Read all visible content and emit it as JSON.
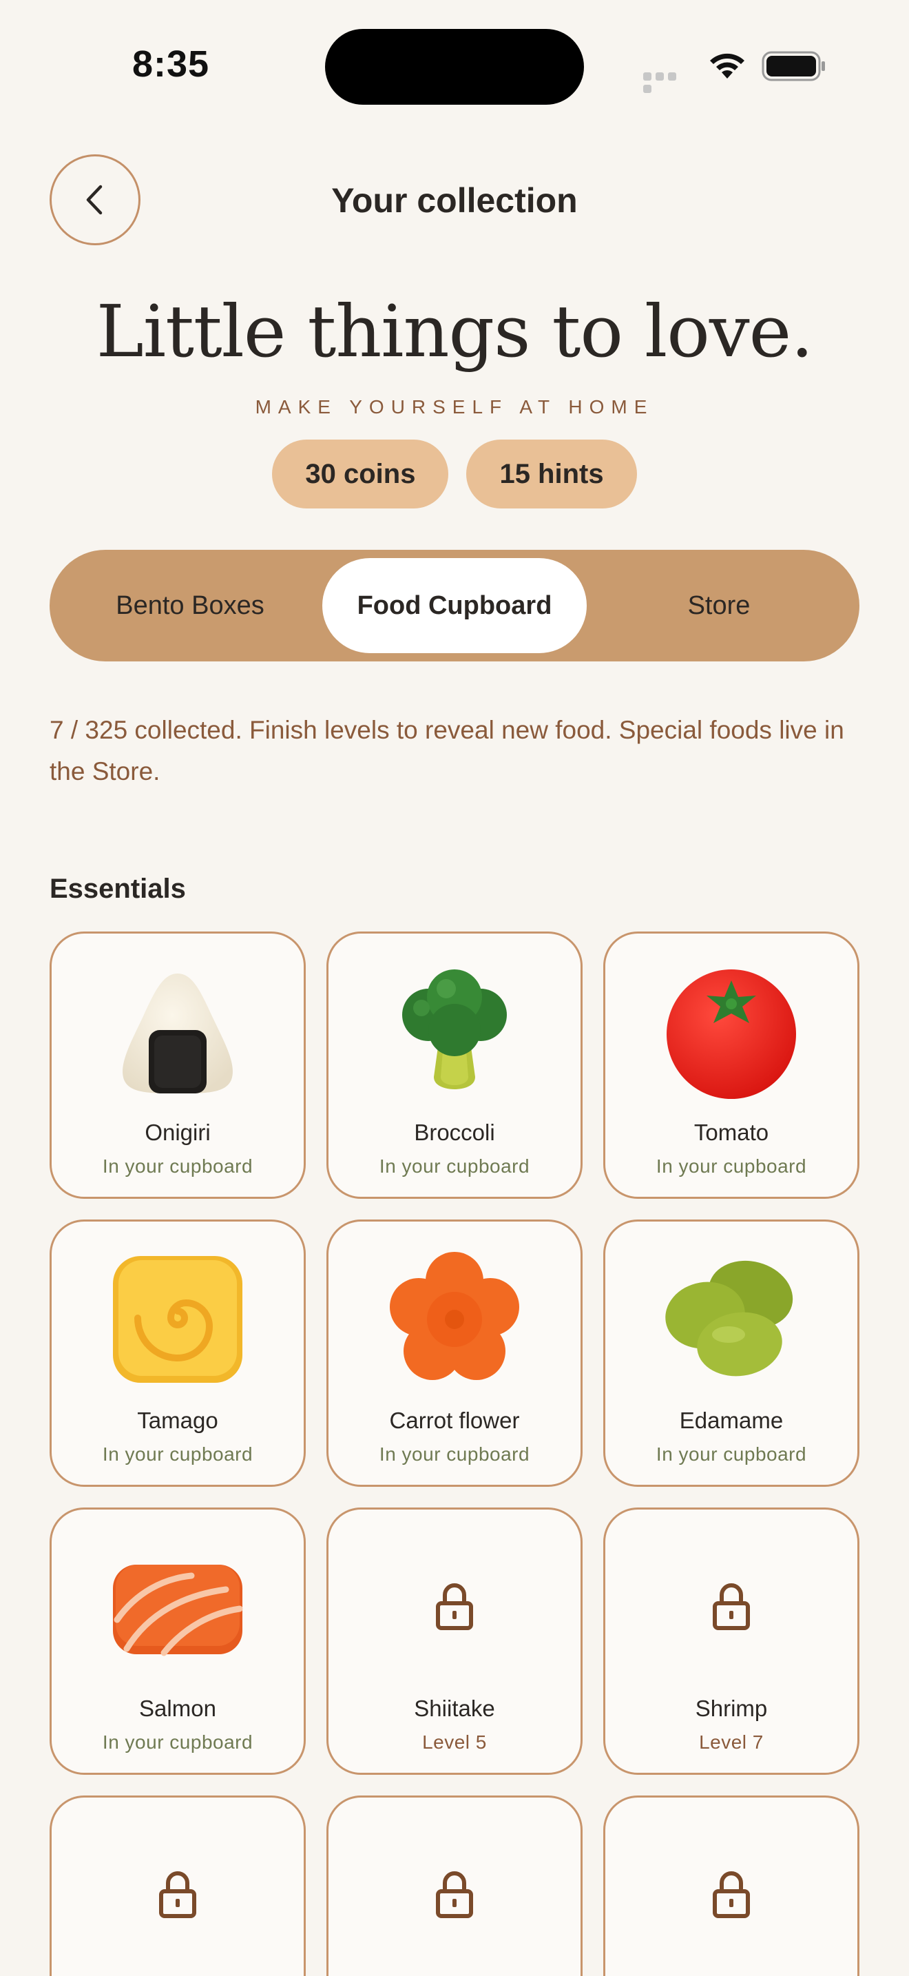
{
  "status_bar": {
    "time": "8:35"
  },
  "header": {
    "title": "Your collection"
  },
  "hero": {
    "title": "Little things to love.",
    "subtitle": "MAKE YOURSELF AT HOME"
  },
  "wallet": {
    "coins": "30 coins",
    "hints": "15 hints"
  },
  "tabs": [
    {
      "label": "Bento Boxes",
      "active": false
    },
    {
      "label": "Food Cupboard",
      "active": true
    },
    {
      "label": "Store",
      "active": false
    }
  ],
  "intro": "7 / 325 collected. Finish levels to reveal new food. Special foods live in the Store.",
  "section": {
    "title": "Essentials"
  },
  "items": [
    {
      "name": "Onigiri",
      "status": "In your cupboard",
      "icon": "onigiri-icon"
    },
    {
      "name": "Broccoli",
      "status": "In your cupboard",
      "icon": "broccoli-icon"
    },
    {
      "name": "Tomato",
      "status": "In your cupboard",
      "icon": "tomato-icon"
    },
    {
      "name": "Tamago",
      "status": "In your cupboard",
      "icon": "tamago-icon"
    },
    {
      "name": "Carrot flower",
      "status": "In your cupboard",
      "icon": "carrot-flower-icon"
    },
    {
      "name": "Edamame",
      "status": "In your cupboard",
      "icon": "edamame-icon"
    },
    {
      "name": "Salmon",
      "status": "In your cupboard",
      "icon": "salmon-icon"
    },
    {
      "name": "Shiitake",
      "status": "Level 5",
      "icon": "lock-icon"
    },
    {
      "name": "Shrimp",
      "status": "Level 7",
      "icon": "lock-icon"
    },
    {
      "name": "",
      "status": "",
      "icon": "lock-icon"
    },
    {
      "name": "",
      "status": "",
      "icon": "lock-icon"
    },
    {
      "name": "",
      "status": "",
      "icon": "lock-icon"
    }
  ],
  "colors": {
    "background": "#f8f5f0",
    "accent": "#c99b6e",
    "pill": "#e9c096",
    "card_border": "#c8956c",
    "muted_text": "#8a5a3b",
    "owned_text": "#6f7a52"
  }
}
